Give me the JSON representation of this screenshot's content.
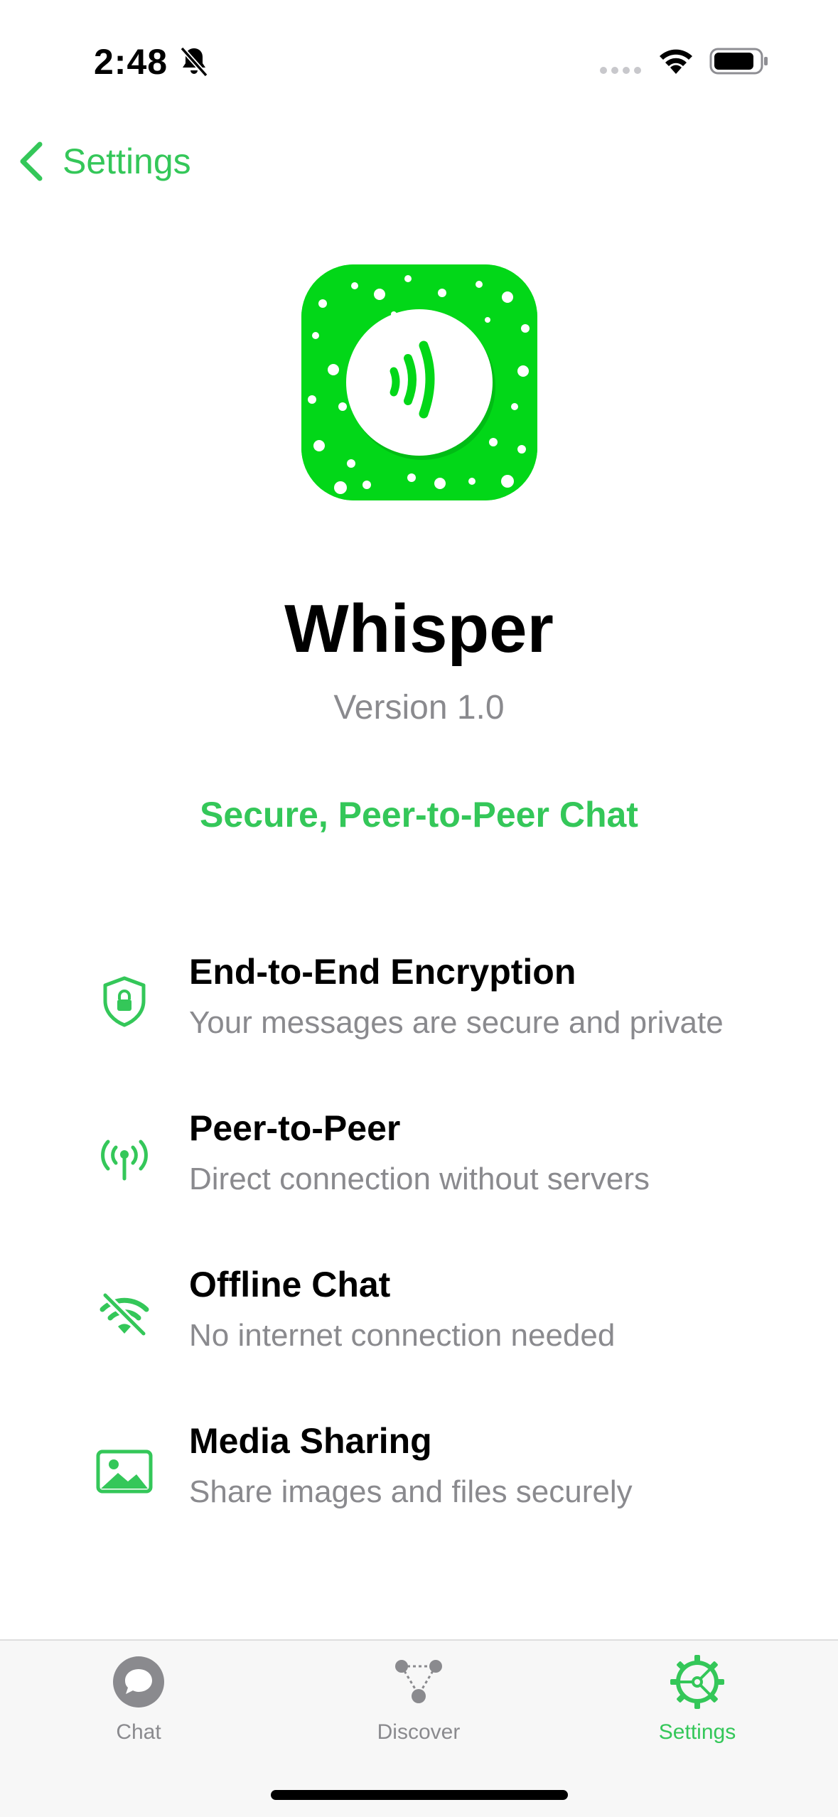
{
  "status_bar": {
    "time": "2:48",
    "icons": [
      "bell-slash-icon",
      "signal-icon",
      "wifi-icon",
      "battery-icon"
    ]
  },
  "nav": {
    "back_label": "Settings"
  },
  "app": {
    "name": "Whisper",
    "version": "Version 1.0",
    "tagline": "Secure, Peer-to-Peer Chat"
  },
  "features": [
    {
      "icon": "lock-shield-icon",
      "title": "End-to-End Encryption",
      "description": "Your messages are secure and private"
    },
    {
      "icon": "antenna-icon",
      "title": "Peer-to-Peer",
      "description": "Direct connection without servers"
    },
    {
      "icon": "wifi-slash-icon",
      "title": "Offline Chat",
      "description": "No internet connection needed"
    },
    {
      "icon": "photo-icon",
      "title": "Media Sharing",
      "description": "Share images and files securely"
    }
  ],
  "tab_bar": {
    "tabs": [
      {
        "label": "Chat",
        "icon": "chat-bubble-icon",
        "active": false
      },
      {
        "label": "Discover",
        "icon": "network-icon",
        "active": false
      },
      {
        "label": "Settings",
        "icon": "gear-icon",
        "active": true
      }
    ]
  },
  "colors": {
    "accent": "#34c759",
    "app_icon_bg": "#02d718",
    "secondary_text": "#8a8a8e",
    "inactive_tab": "#8a8a8e"
  }
}
